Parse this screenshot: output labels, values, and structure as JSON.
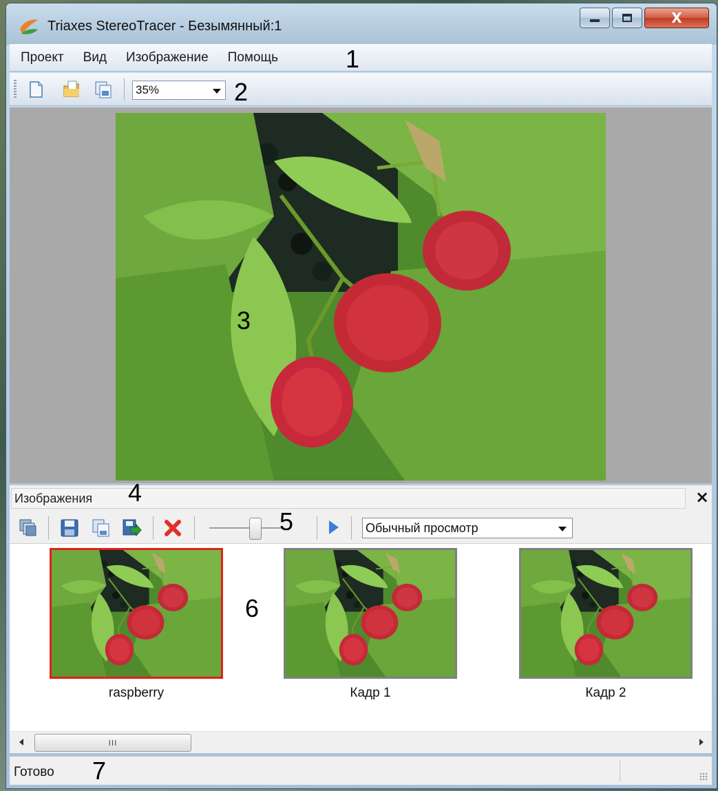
{
  "window": {
    "title": "Triaxes StereoTracer - Безымянный:1",
    "close_symbol": "X"
  },
  "menu": {
    "items": [
      {
        "label": "Проект"
      },
      {
        "label": "Вид"
      },
      {
        "label": "Изображение"
      },
      {
        "label": "Помощь"
      }
    ]
  },
  "toolbar": {
    "zoom_value": "35%",
    "icons": [
      "new-file-icon",
      "open-folder-icon",
      "save-copy-icon"
    ]
  },
  "images_panel": {
    "title": "Изображения",
    "close_symbol": "×",
    "view_mode": "Обычный просмотр",
    "icons": [
      "layers-icon",
      "save-icon",
      "copy-icon",
      "export-icon",
      "delete-icon",
      "play-icon"
    ]
  },
  "thumbnails": [
    {
      "label": "raspberry",
      "selected": true
    },
    {
      "label": "Кадр 1",
      "selected": false
    },
    {
      "label": "Кадр 2",
      "selected": false
    }
  ],
  "scrollbar": {
    "thumb_grip": "III"
  },
  "status": {
    "text": "Готово"
  },
  "callouts": {
    "c1": "1",
    "c2": "2",
    "c3": "3",
    "c4": "4",
    "c5": "5",
    "c6": "6",
    "c7": "7"
  },
  "colors": {
    "selected_border": "#e0201a",
    "close_button": "#c13a22"
  }
}
